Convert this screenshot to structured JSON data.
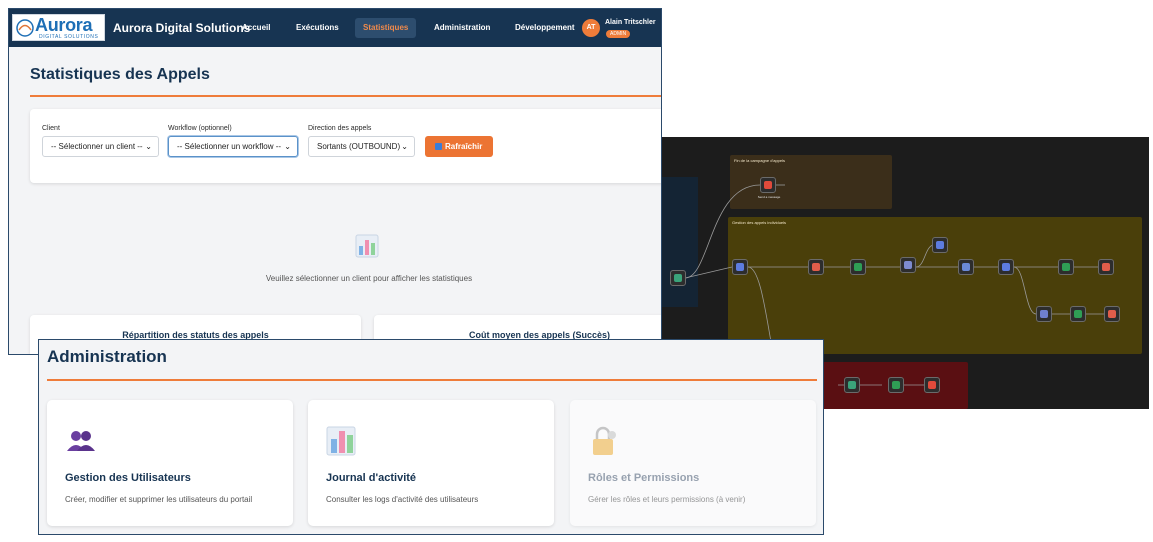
{
  "header": {
    "logo_name": "Aurora",
    "logo_sub": "DIGITAL SOLUTIONS",
    "brand": "Aurora Digital Solutions",
    "nav": [
      {
        "label": "Accueil",
        "active": false
      },
      {
        "label": "Exécutions",
        "active": false
      },
      {
        "label": "Statistiques",
        "active": true
      },
      {
        "label": "Administration",
        "active": false
      },
      {
        "label": "Développement",
        "active": false
      }
    ],
    "user": {
      "initials": "AT",
      "name": "Alain Tritschler",
      "role": "ADMIN"
    }
  },
  "stats_page": {
    "title": "Statistiques des Appels",
    "filters": {
      "client_label": "Client",
      "client_value": "-- Sélectionner un client --",
      "workflow_label": "Workflow (optionnel)",
      "workflow_value": "-- Sélectionner un workflow --",
      "direction_label": "Direction des appels",
      "direction_value": "Sortants (OUTBOUND)",
      "refresh_label": "Rafraîchir"
    },
    "empty_message": "Veuillez sélectionner un client pour afficher les statistiques",
    "cards": [
      {
        "title": "Répartition des statuts des appels"
      },
      {
        "title": "Coût moyen des appels (Succès)"
      }
    ]
  },
  "admin_page": {
    "title": "Administration",
    "cards": [
      {
        "title": "Gestion des Utilisateurs",
        "description": "Créer, modifier et supprimer les utilisateurs du portail",
        "icon": "users-icon"
      },
      {
        "title": "Journal d'activité",
        "description": "Consulter les logs d'activité des utilisateurs",
        "icon": "bar-chart-icon"
      },
      {
        "title": "Rôles et Permissions",
        "description": "Gérer les rôles et leurs permissions (à venir)",
        "icon": "lock-icon"
      }
    ]
  },
  "workflow_editor": {
    "groups": [
      {
        "label": "Fin de la campagne d'appels"
      },
      {
        "label": "Gestion des appels individuels"
      }
    ],
    "colors": {
      "canvas": "#1c1c1c",
      "group_yellow": "#4a3f0a",
      "group_brown": "#3b2e1a",
      "group_red": "#5a0f12"
    }
  },
  "colors": {
    "navy": "#173452",
    "accent": "#ef7c3a",
    "background": "#f3f4f6"
  }
}
